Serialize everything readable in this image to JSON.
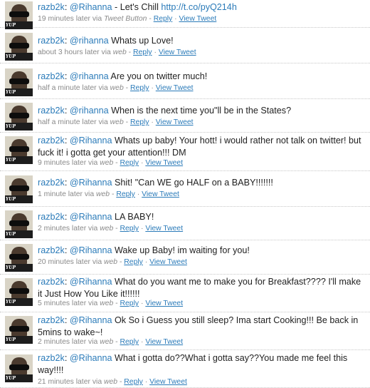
{
  "tweets": [
    {
      "author": "razb2k",
      "mention": "@Rihanna",
      "text": " - Let's Chill ",
      "link": "http://t.co/pyQ214h",
      "time": "19 minutes later via",
      "source": "Tweet Button",
      "reply": "Reply",
      "view": "View Tweet",
      "avatar_tag": "YUP"
    },
    {
      "author": "razb2k",
      "mention": "@rihanna",
      "text": " Whats up Love!",
      "link": "",
      "time": "about 3 hours later via",
      "source": "web",
      "reply": "Reply",
      "view": "View Tweet",
      "avatar_tag": "YUP"
    },
    {
      "author": "razb2k",
      "mention": "@rihanna",
      "text": " Are you on twitter much!",
      "link": "",
      "time": "half a minute later via",
      "source": "web",
      "reply": "Reply",
      "view": "View Tweet",
      "avatar_tag": "YUP"
    },
    {
      "author": "razb2k",
      "mention": "@rihanna",
      "text": " When is the next time you\"ll be in the States?",
      "link": "",
      "time": "half a minute later via",
      "source": "web",
      "reply": "Reply",
      "view": "View Tweet",
      "avatar_tag": "YUP"
    },
    {
      "author": "razb2k",
      "mention": "@Rihanna",
      "text": " Whats up baby! Your hott! i would rather not talk on twitter! but fuck it! i gotta get your attention!!! DM",
      "link": "",
      "time": "9 minutes later via",
      "source": "web",
      "reply": "Reply",
      "view": "View Tweet",
      "avatar_tag": "YUP"
    },
    {
      "author": "razb2k",
      "mention": "@Rihanna",
      "text": " Shit! \"Can WE go HALF on a BABY!!!!!!!",
      "link": "",
      "time": "1 minute later via",
      "source": "web",
      "reply": "Reply",
      "view": "View Tweet",
      "avatar_tag": "YUP"
    },
    {
      "author": "razb2k",
      "mention": "@Rihanna",
      "text": " LA BABY!",
      "link": "",
      "time": "2 minutes later via",
      "source": "web",
      "reply": "Reply",
      "view": "View Tweet",
      "avatar_tag": "YUP"
    },
    {
      "author": "razb2k",
      "mention": "@Rihanna",
      "text": " Wake up Baby! im waiting for you!",
      "link": "",
      "time": "20 minutes later via",
      "source": "web",
      "reply": "Reply",
      "view": "View Tweet",
      "avatar_tag": "YUP"
    },
    {
      "author": "razb2k",
      "mention": "@Rihanna",
      "text": " What do you want me to make you for Breakfast???? I'll make it Just How You Like it!!!!!!",
      "link": "",
      "time": "5 minutes later via",
      "source": "web",
      "reply": "Reply",
      "view": "View Tweet",
      "avatar_tag": "YUP"
    },
    {
      "author": "razb2k",
      "mention": "@Rihanna",
      "text": " Ok So i Guess you still sleep? Ima start Cooking!!! Be back in 5mins to wake~!",
      "link": "",
      "time": "2 minutes later via",
      "source": "web",
      "reply": "Reply",
      "view": "View Tweet",
      "avatar_tag": "YUP"
    },
    {
      "author": "razb2k",
      "mention": "@Rihanna",
      "text": " What i gotta do??What i gotta say??You made me feel this way!!!!",
      "link": "",
      "time": "21 minutes later via",
      "source": "web",
      "reply": "Reply",
      "view": "View Tweet",
      "avatar_tag": "YUP"
    }
  ],
  "separators": {
    "colon": ": ",
    "dash": " - ",
    "dot": " · "
  }
}
